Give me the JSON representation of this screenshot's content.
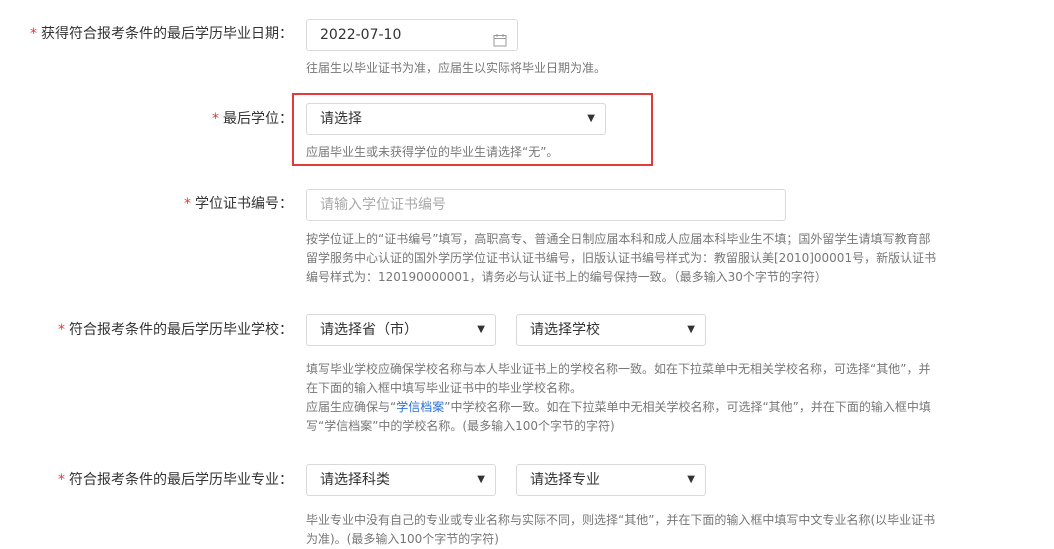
{
  "fields": {
    "grad_date": {
      "label": "获得符合报考条件的最后学历毕业日期：",
      "value": "2022-07-10",
      "hint": "往届生以毕业证书为准，应届生以实际将毕业日期为准。"
    },
    "degree": {
      "label": "最后学位：",
      "value": "请选择",
      "hint": "应届毕业生或未获得学位的毕业生请选择“无”。"
    },
    "degree_cert": {
      "label": "学位证书编号：",
      "placeholder": "请输入学位证书编号",
      "hint_line1": "按学位证上的“证书编号”填写，高职高专、普通全日制应届本科和成人应届本科毕业生不填；国外留学生请填写教育部",
      "hint_line2": "留学服务中心认证的国外学历学位证书认证书编号，旧版认证书编号样式为：教留服认美[2010]00001号，新版认证书",
      "hint_line3": "编号样式为：120190000001，请务必与认证书上的编号保持一致。（最多输入30个字节的字符）"
    },
    "school": {
      "label": "符合报考条件的最后学历毕业学校：",
      "province_value": "请选择省（市）",
      "school_value": "请选择学校",
      "hint_line1": "填写毕业学校应确保学校名称与本人毕业证书上的学校名称一致。如在下拉菜单中无相关学校名称，可选择“其他”，并",
      "hint_line2": "在下面的输入框中填写毕业证书中的毕业学校名称。",
      "hint_line3_pre": "应届生应确保与“",
      "hint_line3_link": "学信档案",
      "hint_line3_post": "”中学校名称一致。如在下拉菜单中无相关学校名称，可选择“其他”，并在下面的输入框中填",
      "hint_line4": "写“学信档案”中的学校名称。(最多输入100个字节的字符)"
    },
    "major": {
      "label": "符合报考条件的最后学历毕业专业：",
      "category_value": "请选择科类",
      "major_value": "请选择专业",
      "hint_line1": "毕业专业中没有自己的专业或专业名称与实际不同，则选择“其他”，并在下面的输入框中填写中文专业名称(以毕业证书",
      "hint_line2": "为准)。(最多输入100个字节的字符)"
    }
  },
  "required_mark": "*",
  "colors": {
    "required": "#e4393c",
    "highlight": "#e13b3b",
    "link": "#2f6fd8"
  }
}
